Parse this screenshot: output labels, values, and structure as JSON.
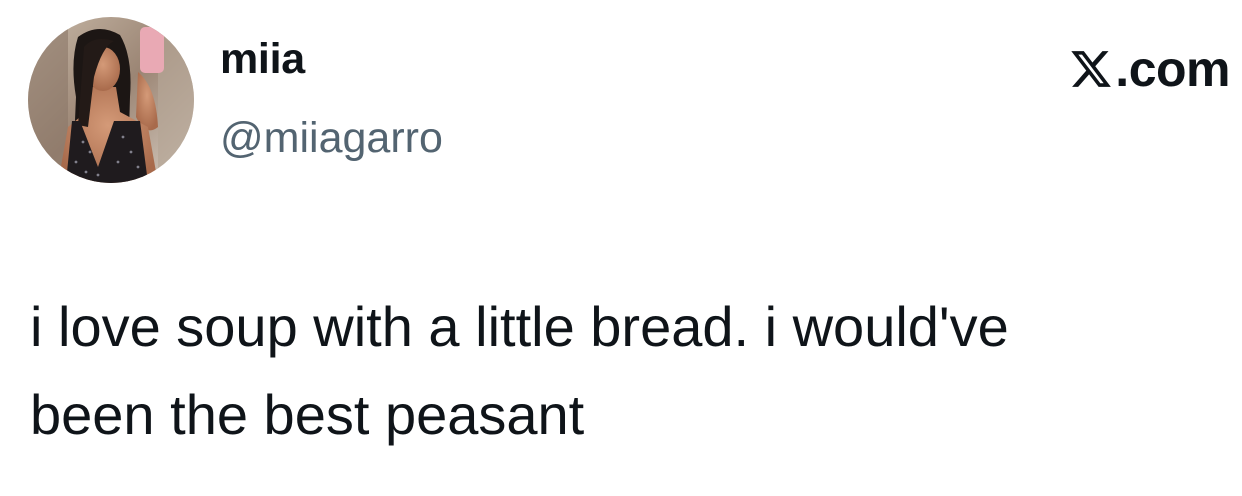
{
  "author": {
    "display_name": "miia",
    "handle": "@miiagarro",
    "avatar_icon": "profile-photo"
  },
  "brand": {
    "logo_icon": "x-logo-icon",
    "text": ".com"
  },
  "tweet": {
    "lines": [
      "i love soup with a little bread. i would've",
      "been the best peasant"
    ]
  },
  "colors": {
    "text_primary": "#0f1419",
    "text_secondary": "#536471",
    "background": "#ffffff"
  }
}
